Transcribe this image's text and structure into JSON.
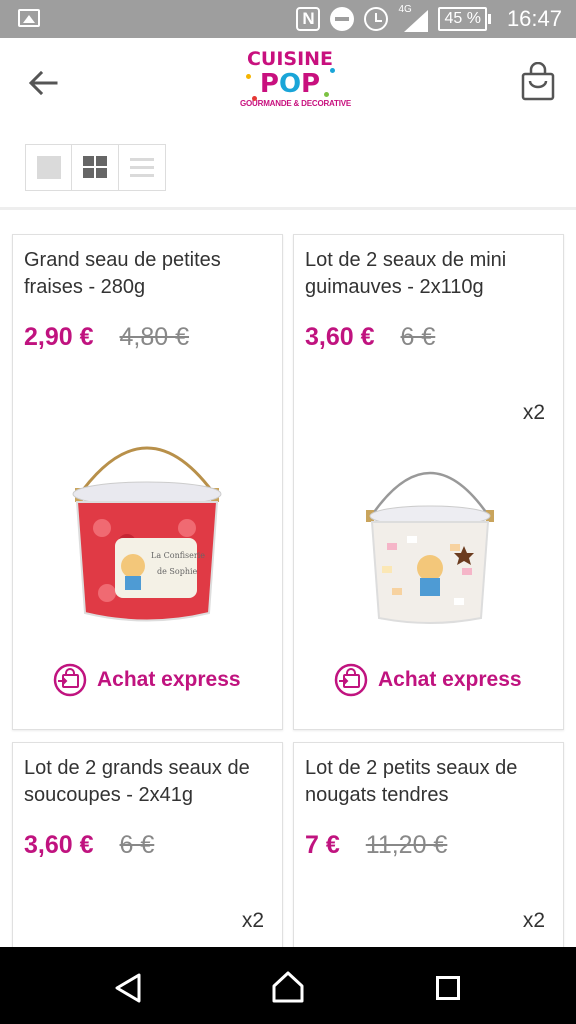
{
  "status_bar": {
    "network_label": "4G",
    "battery": "45 %",
    "time": "16:47"
  },
  "header": {
    "logo_line1": "CUISINE",
    "logo_line2_a": "P",
    "logo_line2_b": "O",
    "logo_line2_c": "P",
    "logo_tagline": "GOURMANDE & DECORATIVE"
  },
  "view_toggle": {
    "options": [
      "single",
      "grid",
      "list"
    ],
    "selected": "grid"
  },
  "products": [
    {
      "title": "Grand seau de petites fraises  -  280g",
      "price": "2,90 €",
      "old_price": "4,80 €",
      "quantity_badge": "",
      "action": "Achat express",
      "image": "strawberry-candy-bucket"
    },
    {
      "title": "Lot de 2 seaux de mini guimauves  -  2x110g",
      "price": "3,60 €",
      "old_price": "6 €",
      "quantity_badge": "x2",
      "action": "Achat express",
      "image": "marshmallow-bucket"
    },
    {
      "title": "Lot de 2 grands seaux de soucoupes  - 2x41g",
      "price": "3,60 €",
      "old_price": "6 €",
      "quantity_badge": "x2",
      "action": "",
      "image": ""
    },
    {
      "title": "Lot de 2 petits seaux de nougats tendres",
      "price": "7 €",
      "old_price": "11,20 €",
      "quantity_badge": "x2",
      "action": "",
      "image": ""
    }
  ],
  "colors": {
    "accent": "#c0137f",
    "status_bar": "#9e9e9e",
    "nav_bar": "#000000"
  }
}
